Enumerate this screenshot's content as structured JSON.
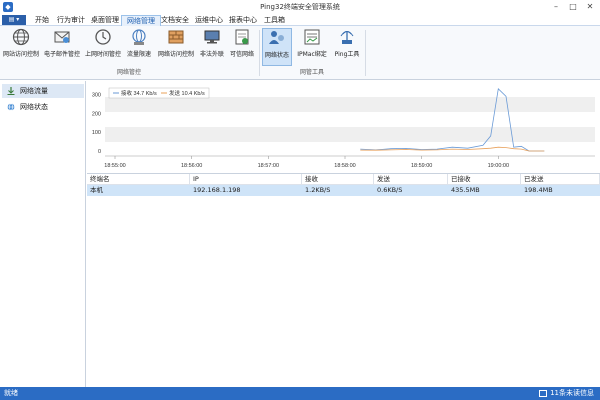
{
  "window": {
    "title": "Ping32终端安全管理系统",
    "icon": "shield-icon"
  },
  "menu": {
    "file_label": "▤ ▾",
    "items": [
      "开始",
      "行为审计",
      "桌面管理",
      "网络管理",
      "文档安全",
      "运维中心",
      "报表中心",
      "工具箱"
    ],
    "active": "网络管理"
  },
  "ribbon": {
    "groups": [
      {
        "label": "网络管控",
        "buttons": [
          "网站访问控制",
          "电子邮件管控",
          "上网时间管控",
          "流量限速",
          "网络访问控制",
          "非法外联",
          "可信网络"
        ]
      },
      {
        "label": "网管工具",
        "buttons": [
          "网络状态",
          "IPMac绑定",
          "Ping工具"
        ]
      }
    ],
    "active_button": "网络状态"
  },
  "sidebar": {
    "items": [
      {
        "label": "网络流量",
        "icon": "download-icon",
        "active": true
      },
      {
        "label": "网络状态",
        "icon": "globe-icon",
        "active": false
      }
    ]
  },
  "chart_data": {
    "type": "line",
    "legend": [
      "接收 34.7 Kb/s",
      "发送 10.4 Kb/s"
    ],
    "y_ticks": [
      "300",
      "200",
      "100",
      "0"
    ],
    "x_ticks": [
      "18:55:00",
      "18:56:00",
      "18:57:00",
      "18:58:00",
      "18:59:00",
      "19:00:00"
    ],
    "ylim": [
      0,
      350
    ],
    "x_minutes": [
      3.2,
      3.4,
      3.6,
      3.8,
      4.0,
      4.2,
      4.4,
      4.6,
      4.8,
      4.9,
      5.0,
      5.1,
      5.2,
      5.3,
      5.4,
      5.5,
      5.6
    ],
    "series": [
      {
        "name": "接收 34.7 Kb/s",
        "color": "#6a9ad6",
        "values": [
          10,
          6,
          12,
          14,
          8,
          10,
          20,
          15,
          30,
          80,
          330,
          290,
          20,
          25,
          0,
          0,
          0
        ]
      },
      {
        "name": "发送 10.4 Kb/s",
        "color": "#e8a05a",
        "values": [
          5,
          4,
          6,
          8,
          5,
          6,
          10,
          8,
          12,
          15,
          20,
          18,
          12,
          10,
          0,
          0,
          0
        ]
      }
    ]
  },
  "table": {
    "columns": [
      "终端名",
      "IP",
      "接收",
      "发送",
      "已接收",
      "已发送"
    ],
    "rows": [
      [
        "本机",
        "192.168.1.198",
        "1.2KB/S",
        "0.6KB/S",
        "435.5MB",
        "198.4MB"
      ]
    ]
  },
  "status": {
    "left": "就绪",
    "right": "11条未读信息",
    "right_icon": "mail-icon"
  }
}
